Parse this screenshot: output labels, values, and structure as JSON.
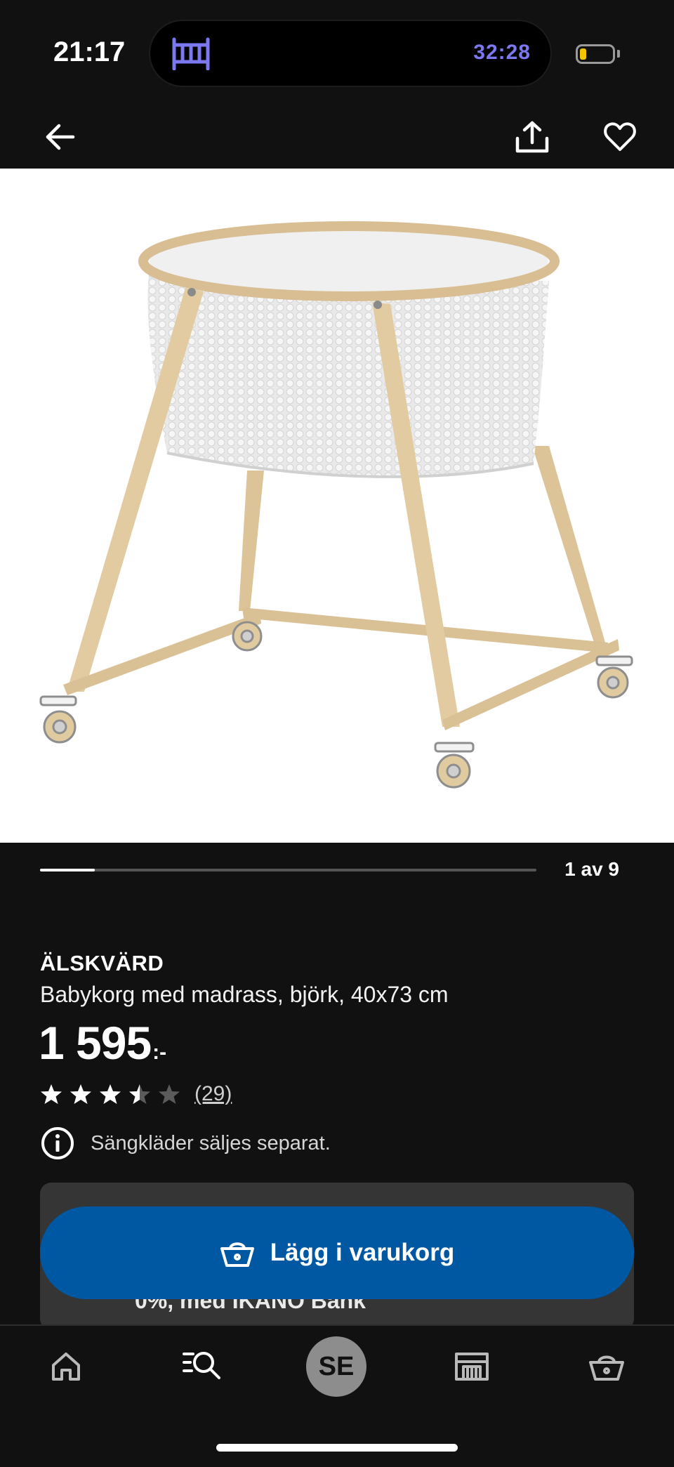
{
  "status_bar": {
    "time": "21:17",
    "activity_timer": "32:28",
    "activity_icon": "crib-icon",
    "timer_color": "#7b78f0",
    "battery_color": "#f2c500"
  },
  "top_nav": {
    "back_icon": "arrow-left-icon",
    "share_icon": "share-icon",
    "favorite_icon": "heart-icon"
  },
  "gallery": {
    "image_subject": "baby-bassinet-birch",
    "counter": "1 av 9",
    "current_index": 1,
    "total": 9,
    "progress_fraction": 0.111
  },
  "product": {
    "name": "ÄLSKVÄRD",
    "description": "Babykorg med madrass, björk, 40x73 cm",
    "price_main": "1 595",
    "price_suffix": ":-",
    "rating": 3.5,
    "rating_max": 5,
    "review_count": "(29)",
    "info_text": "Sängkläder säljes separat."
  },
  "finance_card": {
    "text": "0%, med IKANO Bank"
  },
  "cart_button": {
    "label": "Lägg i varukorg",
    "color": "#0058a3"
  },
  "bottom_nav": {
    "home_icon": "home-icon",
    "search_icon": "search-icon",
    "center_label": "SE",
    "store_icon": "store-icon",
    "cart_icon": "basket-icon"
  }
}
